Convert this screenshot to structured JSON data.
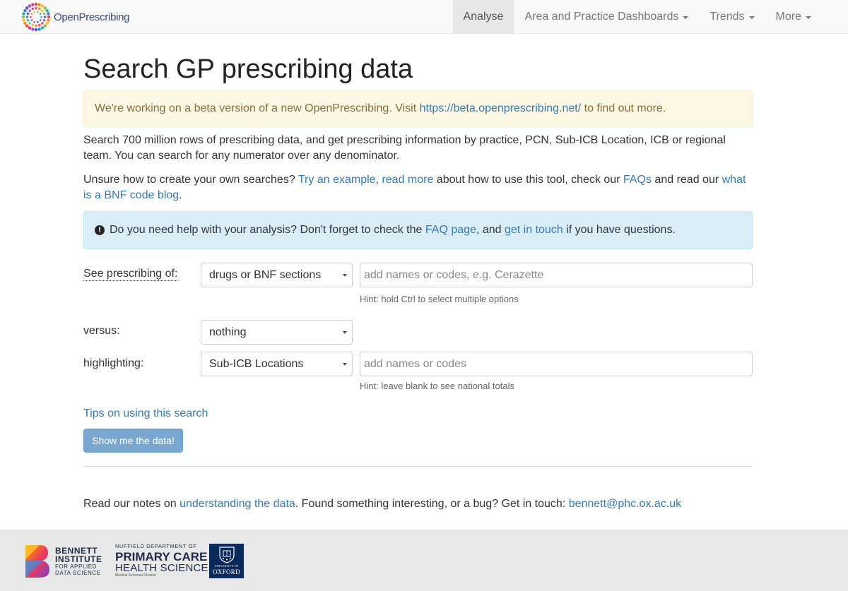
{
  "brand": {
    "name": "OpenPrescribing"
  },
  "nav": {
    "items": [
      {
        "label": "Analyse",
        "active": true,
        "dropdown": false
      },
      {
        "label": "Area and Practice Dashboards",
        "dropdown": true
      },
      {
        "label": "Trends",
        "dropdown": true
      },
      {
        "label": "More",
        "dropdown": true
      }
    ]
  },
  "page": {
    "title": "Search GP prescribing data",
    "beta": {
      "prefix": "We're working on a beta version of a new OpenPrescribing. Visit ",
      "link": "https://beta.openprescribing.net/",
      "suffix": " to find out more."
    },
    "intro": "Search 700 million rows of prescribing data, and get prescribing information by practice, PCN, Sub-ICB Location, ICB or regional team. You can search for any numerator over any denominator.",
    "help": {
      "t1": "Unsure how to create your own searches? ",
      "l1": "Try an example",
      "t2": ", ",
      "l2": "read more",
      "t3": " about how to use this tool, check our ",
      "l3": "FAQs",
      "t4": " and read our ",
      "l4": "what is a BNF code blog",
      "t5": "."
    },
    "info": {
      "t1": "Do you need help with your analysis? Don't forget to check the ",
      "l1": "FAQ page",
      "t2": ", and ",
      "l2": "get in touch",
      "t3": " if you have questions."
    }
  },
  "form": {
    "see_label": "See prescribing of:",
    "see_select": "drugs or BNF sections",
    "see_placeholder": "add names or codes, e.g. Cerazette",
    "see_hint": "Hint: hold Ctrl to select multiple options",
    "versus_label": "versus:",
    "versus_select": "nothing",
    "highlight_label": "highlighting:",
    "highlight_select": "Sub-ICB Locations",
    "highlight_placeholder": "add names or codes",
    "highlight_hint": "Hint: leave blank to see national totals",
    "tips_link": "Tips on using this search",
    "submit_label": "Show me the data!"
  },
  "notes": {
    "t1": "Read our notes on ",
    "l1": "understanding the data",
    "t2": ". Found something interesting, or a bug? Get in touch: ",
    "email": "bennett@phc.ox.ac.uk"
  },
  "footer": {
    "bennett_line1": "BENNETT",
    "bennett_line2": "INSTITUTE",
    "bennett_line3": "FOR APPLIED",
    "bennett_line4": "DATA SCIENCE",
    "nuffield_line1": "NUFFIELD DEPARTMENT OF",
    "nuffield_line2": "PRIMARY CARE",
    "nuffield_line3": "HEALTH SCIENCES",
    "nuffield_line4": "Medical Sciences Division",
    "oxford_line1": "UNIVERSITY OF",
    "oxford_line2": "OXFORD"
  },
  "colors": {
    "link": "#337ab7",
    "warning_bg": "#fcf8e3",
    "info_bg": "#d9edf7",
    "button": "#7aa7d0"
  }
}
